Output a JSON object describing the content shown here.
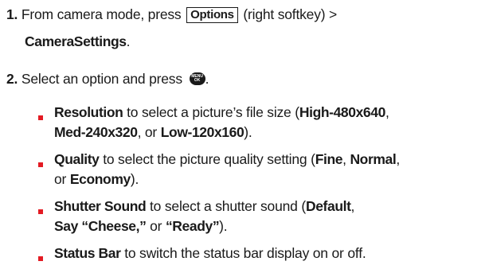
{
  "colors": {
    "text": "#1a1a1a",
    "bullet": "#e31b23"
  },
  "step1": {
    "number": "1.",
    "text_before": "From camera mode, press",
    "key_label": "Options",
    "text_after": "(right softkey) >",
    "target": "CameraSettings",
    "period": "."
  },
  "step2": {
    "number": "2.",
    "text": "Select an option and press",
    "icon": "menu-ok-key-icon",
    "icon_top": "MENU",
    "icon_bottom": "OK",
    "period": "."
  },
  "options": [
    {
      "title": "Resolution",
      "line1_text": "to select a picture’s file size (",
      "v1": "High-480x640",
      "sep1": ",",
      "v2": "Med-240x320",
      "sep2": ", or",
      "v3": "Low-120x160",
      "end": ")."
    },
    {
      "title": "Quality",
      "line1_text": "to select the picture quality setting (",
      "v1": "Fine",
      "sep1": ",",
      "v2": "Normal",
      "sep2": ",",
      "line2_pre": "or",
      "v3": "Economy",
      "end": ")."
    },
    {
      "title": "Shutter Sound",
      "line1_text": "to select a shutter sound (",
      "v1": "Default",
      "sep1": ",",
      "v2": "Say “Cheese,”",
      "sep2": "or",
      "v3": "“Ready”",
      "end": ")."
    },
    {
      "title": "Status Bar",
      "line1_text": "to switch the status bar display on or off."
    }
  ]
}
